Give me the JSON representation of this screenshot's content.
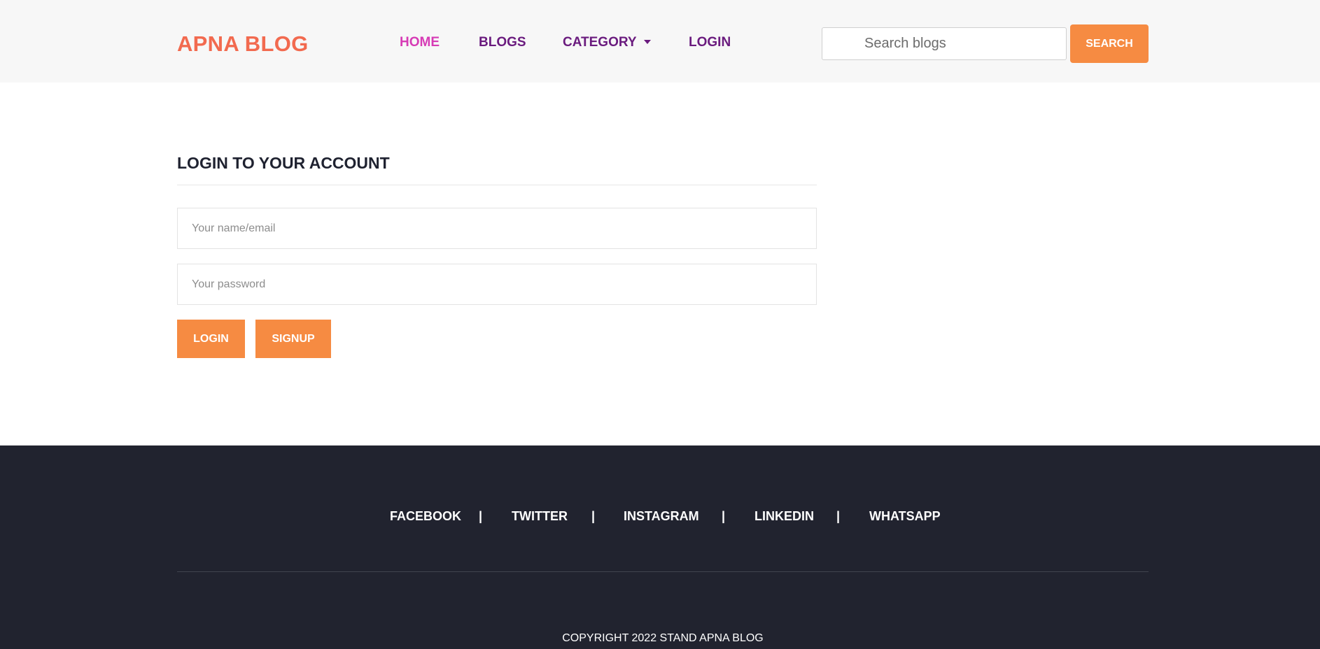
{
  "header": {
    "brand": "APNA BLOG",
    "nav": {
      "home": "HOME",
      "blogs": "BLOGS",
      "category": "CATEGORY",
      "login": "LOGIN"
    },
    "search": {
      "placeholder": "Search blogs",
      "value": "",
      "button_label": "SEARCH"
    }
  },
  "login_form": {
    "title": "LOGIN TO YOUR ACCOUNT",
    "name_placeholder": "Your name/email",
    "password_placeholder": "Your password",
    "login_label": "LOGIN",
    "signup_label": "SIGNUP"
  },
  "footer": {
    "social": [
      "FACEBOOK",
      "TWITTER",
      "INSTAGRAM",
      "LINKEDIN",
      "WHATSAPP"
    ],
    "separator": "|",
    "copyright": "COPYRIGHT 2022 STAND APNA BLOG"
  },
  "colors": {
    "brand": "#f26a4f",
    "nav_text": "#6a1b7e",
    "nav_active": "#d63bb5",
    "accent_button": "#f68b42",
    "footer_bg": "#21232f",
    "header_bg": "#f7f7f7"
  },
  "icons": {
    "category_dropdown": "caret-down-icon"
  }
}
